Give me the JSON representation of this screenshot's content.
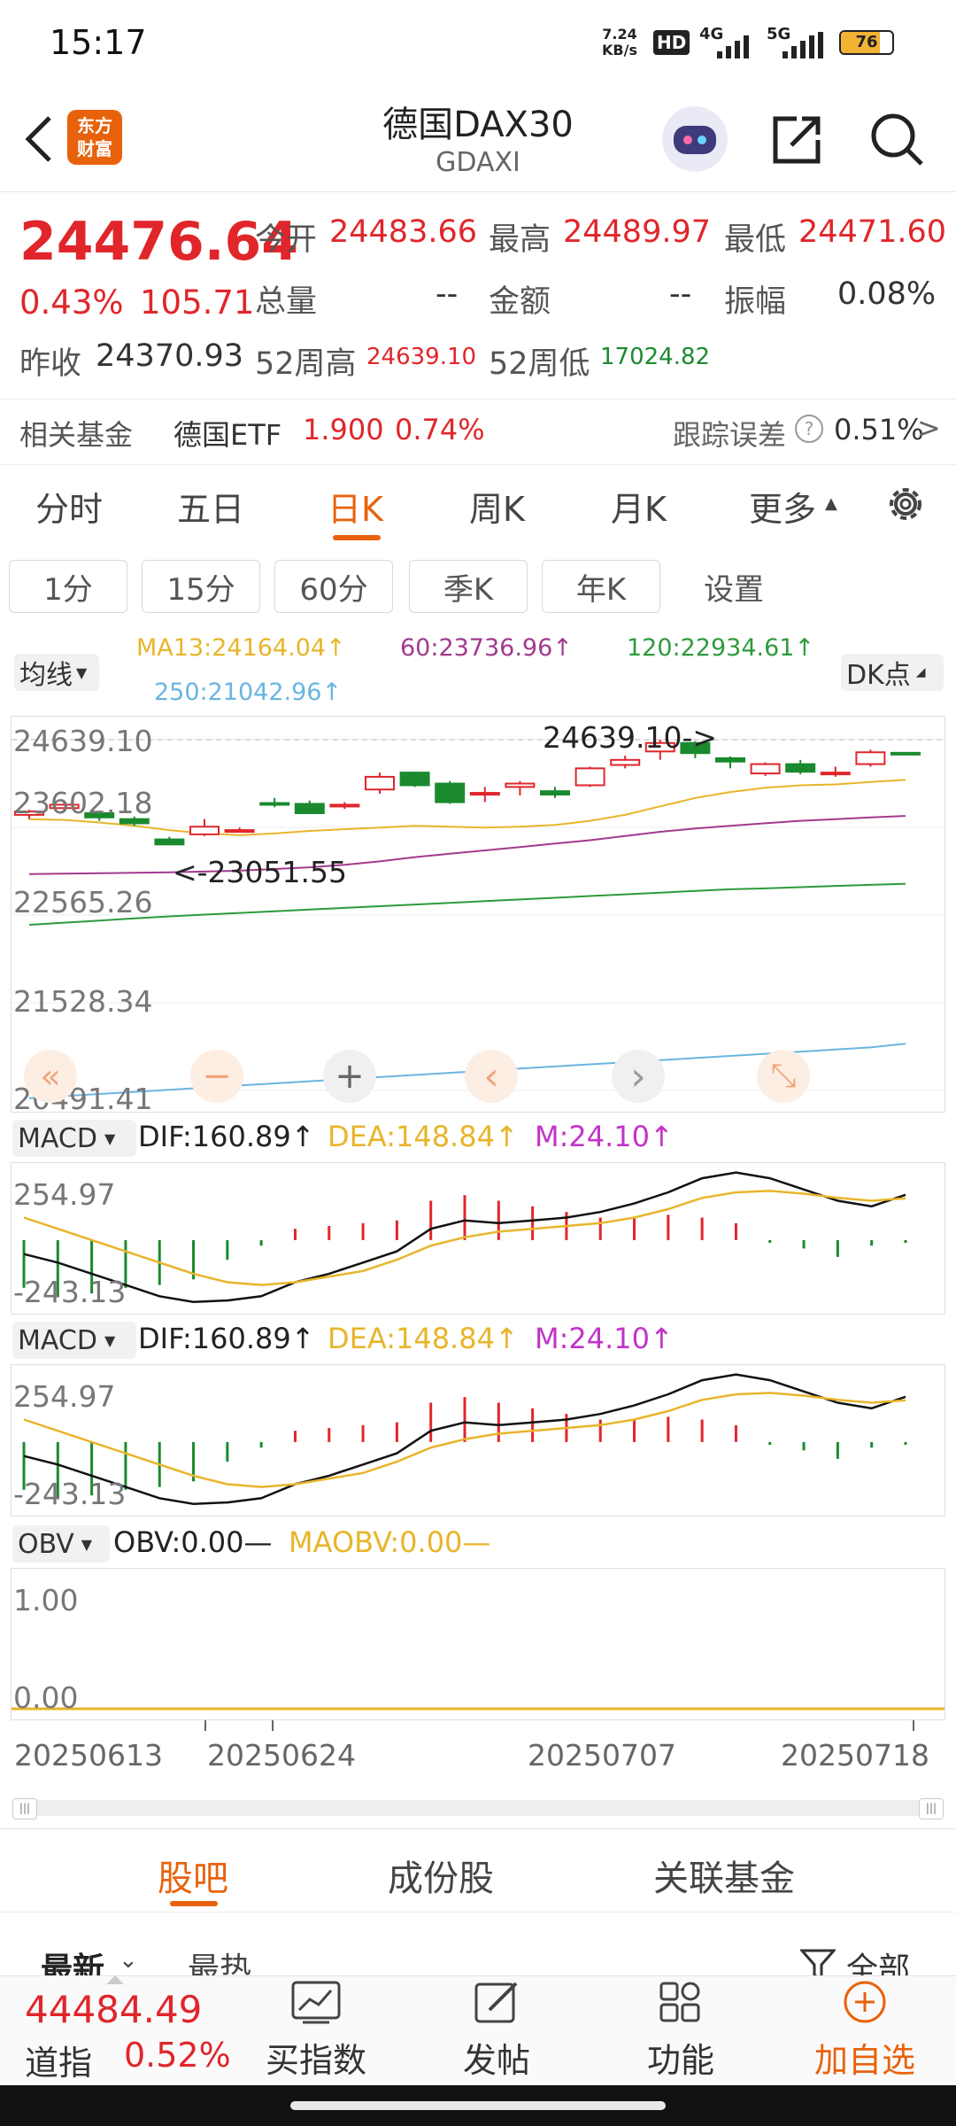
{
  "status_bar": {
    "time": "15:17",
    "net_speed_top": "7.24",
    "net_speed_bottom": "KB/s",
    "hd": "HD",
    "sig1": "4G",
    "sig2": "5G",
    "battery": "76"
  },
  "header": {
    "title": "德国DAX30",
    "subtitle": "GDAXI",
    "logo_line1": "东方",
    "logo_line2": "财富"
  },
  "quote": {
    "price": "24476.64",
    "change_pct": "0.43%",
    "change_abs": "105.71",
    "open_label": "今开",
    "open": "24483.66",
    "high_label": "最高",
    "high": "24489.97",
    "low_label": "最低",
    "low": "24471.60",
    "volume_label": "总量",
    "volume": "--",
    "amount_label": "金额",
    "amount": "--",
    "amplitude_label": "振幅",
    "amplitude": "0.08%",
    "prev_close_label": "昨收",
    "prev_close": "24370.93",
    "wk52_high_label": "52周高",
    "wk52_high": "24639.10",
    "wk52_low_label": "52周低",
    "wk52_low": "17024.82"
  },
  "fund": {
    "label": "相关基金",
    "name": "德国ETF",
    "price": "1.900",
    "pct": "0.74%",
    "tracking_label": "跟踪误差",
    "tracking_value": "0.51%",
    "arrow": ">"
  },
  "period_tabs": [
    "分时",
    "五日",
    "日K",
    "周K",
    "月K",
    "更多"
  ],
  "sub_tabs": [
    "1分",
    "15分",
    "60分",
    "季K",
    "年K",
    "设置"
  ],
  "ma": {
    "selector": "均线",
    "ma13": "MA13:24164.04↑",
    "ma60": "60:23736.96↑",
    "ma120": "120:22934.61↑",
    "ma250": "250:21042.96↑",
    "dk": "DK点"
  },
  "kline_axis": [
    "24639.10",
    "23602.18",
    "22565.26",
    "21528.34",
    "20491.41"
  ],
  "kline_annotations": {
    "high": "24639.10->",
    "low": "<-23051.55"
  },
  "controls": [
    "«",
    "−",
    "+",
    "‹",
    "›",
    "⤡"
  ],
  "macd": {
    "selector": "MACD",
    "dif": "DIF:160.89↑",
    "dea": "DEA:148.84↑",
    "m": "M:24.10↑",
    "axis_top": "254.97",
    "axis_bottom": "-243.13"
  },
  "obv": {
    "selector": "OBV",
    "obv": "OBV:0.00—",
    "maobv": "MAOBV:0.00—",
    "axis_top": "1.00",
    "axis_bottom": "0.00"
  },
  "dates": [
    "20250613",
    "20250624",
    "20250707",
    "20250718"
  ],
  "bottom_tabs": [
    "股吧",
    "成份股",
    "关联基金"
  ],
  "feed_tabs": {
    "latest": "最新",
    "hot": "最热",
    "filter": "全部"
  },
  "ticker": {
    "value": "44484.49",
    "name": "道指",
    "pct": "0.52%"
  },
  "nav": [
    "买指数",
    "发帖",
    "功能",
    "加自选"
  ],
  "colors": {
    "up": "#e0262b",
    "down": "#1b8a2f",
    "accent": "#e8620c",
    "ma13": "#e8b52a",
    "ma60": "#a23a8e",
    "ma120": "#2e9a3d",
    "ma250": "#6ab5e0"
  },
  "chart_data": {
    "type": "candlestick",
    "candles": [
      {
        "o": 23750,
        "c": 23790,
        "h": 23810,
        "l": 23700
      },
      {
        "o": 23830,
        "c": 23870,
        "h": 23900,
        "l": 23800
      },
      {
        "o": 23770,
        "c": 23720,
        "h": 23800,
        "l": 23680
      },
      {
        "o": 23700,
        "c": 23650,
        "h": 23730,
        "l": 23620
      },
      {
        "o": 23460,
        "c": 23400,
        "h": 23490,
        "l": 23390
      },
      {
        "o": 23520,
        "c": 23610,
        "h": 23700,
        "l": 23500
      },
      {
        "o": 23560,
        "c": 23570,
        "h": 23600,
        "l": 23540
      },
      {
        "o": 23890,
        "c": 23870,
        "h": 23950,
        "l": 23840
      },
      {
        "o": 23880,
        "c": 23770,
        "h": 23920,
        "l": 23760
      },
      {
        "o": 23860,
        "c": 23870,
        "h": 23900,
        "l": 23820
      },
      {
        "o": 24050,
        "c": 24200,
        "h": 24250,
        "l": 24000
      },
      {
        "o": 24250,
        "c": 24100,
        "h": 24260,
        "l": 24080
      },
      {
        "o": 24120,
        "c": 23900,
        "h": 24150,
        "l": 23880
      },
      {
        "o": 24000,
        "c": 24010,
        "h": 24080,
        "l": 23900
      },
      {
        "o": 24080,
        "c": 24120,
        "h": 24150,
        "l": 23980
      },
      {
        "o": 24030,
        "c": 23990,
        "h": 24080,
        "l": 23950
      },
      {
        "o": 24100,
        "c": 24300,
        "h": 24320,
        "l": 24080
      },
      {
        "o": 24340,
        "c": 24400,
        "h": 24450,
        "l": 24300
      },
      {
        "o": 24500,
        "c": 24600,
        "h": 24639.1,
        "l": 24400
      },
      {
        "o": 24600,
        "c": 24480,
        "h": 24620,
        "l": 24420
      },
      {
        "o": 24420,
        "c": 24380,
        "h": 24440,
        "l": 24300
      },
      {
        "o": 24240,
        "c": 24350,
        "h": 24370,
        "l": 24210
      },
      {
        "o": 24350,
        "c": 24260,
        "h": 24400,
        "l": 24230
      },
      {
        "o": 24230,
        "c": 24250,
        "h": 24320,
        "l": 24200
      },
      {
        "o": 24350,
        "c": 24490,
        "h": 24520,
        "l": 24320
      },
      {
        "o": 24483.66,
        "c": 24476.64,
        "h": 24489.97,
        "l": 24471.6
      }
    ],
    "ma13": [
      23700,
      23690,
      23660,
      23620,
      23570,
      23530,
      23510,
      23530,
      23560,
      23580,
      23600,
      23620,
      23610,
      23600,
      23610,
      23630,
      23680,
      23750,
      23850,
      23950,
      24020,
      24070,
      24100,
      24110,
      24140,
      24164.04
    ],
    "ma60": [
      23050,
      23055,
      23060,
      23065,
      23070,
      23080,
      23090,
      23110,
      23130,
      23160,
      23200,
      23250,
      23290,
      23330,
      23370,
      23410,
      23450,
      23500,
      23550,
      23590,
      23620,
      23650,
      23680,
      23700,
      23720,
      23736.96
    ],
    "ma120": [
      22450,
      22475,
      22500,
      22525,
      22550,
      22570,
      22590,
      22610,
      22630,
      22650,
      22670,
      22690,
      22710,
      22730,
      22750,
      22770,
      22790,
      22810,
      22830,
      22850,
      22870,
      22880,
      22895,
      22910,
      22922,
      22934.61
    ],
    "ma250": [
      20400,
      20425,
      20450,
      20475,
      20500,
      20525,
      20550,
      20575,
      20600,
      20625,
      20650,
      20675,
      20700,
      20725,
      20750,
      20775,
      20800,
      20825,
      20850,
      20875,
      20900,
      20925,
      20950,
      20975,
      21000,
      21042.96
    ],
    "macd_bars": [
      -170,
      -200,
      -190,
      -170,
      -160,
      -140,
      -70,
      -20,
      40,
      50,
      60,
      70,
      140,
      160,
      140,
      120,
      100,
      80,
      80,
      90,
      80,
      60,
      -10,
      -30,
      -60,
      -20,
      -10
    ],
    "dif": [
      -50,
      -80,
      -120,
      -160,
      -200,
      -220,
      -215,
      -200,
      -150,
      -120,
      -80,
      -40,
      40,
      70,
      60,
      70,
      80,
      100,
      130,
      170,
      220,
      240,
      220,
      180,
      140,
      120,
      160.89
    ],
    "dea": [
      80,
      40,
      0,
      -40,
      -80,
      -120,
      -150,
      -160,
      -150,
      -130,
      -110,
      -70,
      -20,
      10,
      30,
      40,
      50,
      60,
      80,
      110,
      150,
      170,
      175,
      165,
      150,
      140,
      148.84
    ],
    "macd_range": [
      -243.13,
      254.97
    ],
    "kline_range": [
      20491.41,
      24639.1
    ]
  }
}
